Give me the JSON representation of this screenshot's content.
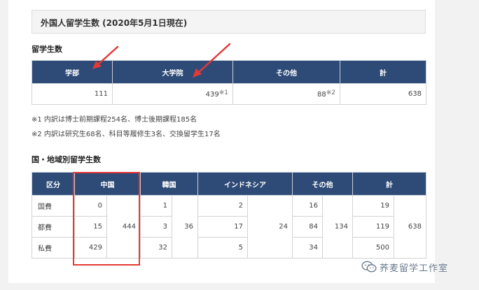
{
  "heading": "外国人留学生数 (2020年5月1日現在)",
  "sections": {
    "students_title": "留学生数",
    "country_title": "国・地域別留学生数"
  },
  "students_table": {
    "headers": [
      "学部",
      "大学院",
      "その他",
      "計"
    ],
    "undergrad": "111",
    "graduate": "439",
    "graduate_note": "※1",
    "other": "88",
    "other_note": "※2",
    "total": "638"
  },
  "footnotes": [
    "※1 内訳は博士前期課程254名、博士後期課程185名",
    "※2 内訳は研究生68名、科目等履修生3名、交換留学生17名"
  ],
  "country_table": {
    "headers": [
      "区分",
      "中国",
      "韓国",
      "インドネシア",
      "その他",
      "計"
    ],
    "rows": [
      {
        "label": "国費",
        "china": "0",
        "korea": "1",
        "indonesia": "2",
        "other": "16",
        "total": "19"
      },
      {
        "label": "都費",
        "china": "15",
        "korea": "3",
        "indonesia": "17",
        "other": "84",
        "total": "119"
      },
      {
        "label": "私費",
        "china": "429",
        "korea": "32",
        "indonesia": "5",
        "other": "34",
        "total": "500"
      }
    ],
    "subtotals": {
      "china": "444",
      "korea": "36",
      "indonesia": "24",
      "other": "134",
      "total": "638"
    }
  },
  "watermark": {
    "text": "荞麦留学工作室",
    "icon": "wechat-icon"
  },
  "colors": {
    "header_bg": "#2e4b77",
    "highlight": "#e53935"
  }
}
